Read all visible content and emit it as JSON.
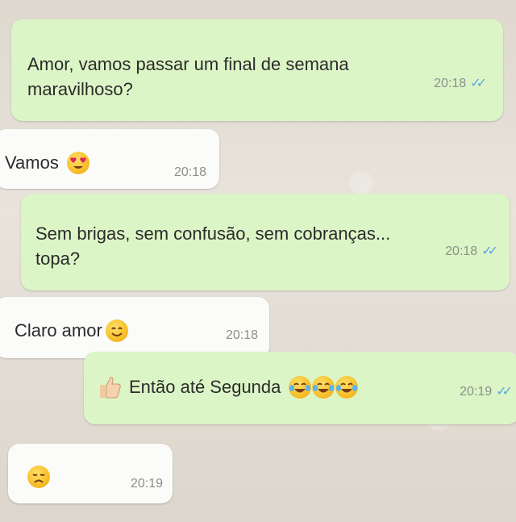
{
  "messages": [
    {
      "id": "m1",
      "direction": "outgoing",
      "text_line1": "Amor, vamos passar um final de semana",
      "text_line2": "maravilhoso?",
      "time": "20:18",
      "status": "read"
    },
    {
      "id": "m2",
      "direction": "incoming",
      "text": "Vamos",
      "emoji": "heart-eyes-emoji",
      "time": "20:18"
    },
    {
      "id": "m3",
      "direction": "outgoing",
      "text_line1": "Sem brigas, sem confusão, sem cobranças...",
      "text_line2": "topa?",
      "time": "20:18",
      "status": "read"
    },
    {
      "id": "m4",
      "direction": "incoming",
      "text": "Claro amor",
      "emoji": "smiling-emoji",
      "time": "20:18"
    },
    {
      "id": "m5",
      "direction": "outgoing",
      "text": "Então até Segunda",
      "emoji_prefix": "thumbs-up-emoji",
      "emoji_suffix": [
        "tears-of-joy-emoji",
        "tears-of-joy-emoji",
        "tears-of-joy-emoji"
      ],
      "time": "20:19",
      "status": "read"
    },
    {
      "id": "m6",
      "direction": "incoming",
      "text": "",
      "emoji": "sad-face-emoji",
      "time": "20:19"
    }
  ],
  "ticks_glyph": "✓✓",
  "colors": {
    "outgoing_bubble": "#dcf5c6",
    "incoming_bubble": "#fbfbfa",
    "read_ticks": "#5aa5e6",
    "timestamp": "#8a8f8a"
  }
}
